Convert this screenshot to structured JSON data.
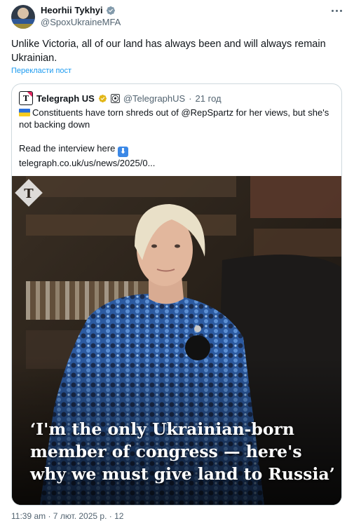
{
  "author": {
    "name": "Heorhii Tykhyi",
    "handle": "@SpoxUkraineMFA"
  },
  "tweet": {
    "text": "Unlike Victoria, all of our land has always been and will always remain Ukrainian.",
    "translate_label": "Перекласти пост"
  },
  "quote": {
    "name": "Telegraph US",
    "handle": "@TelegraphUS",
    "separator": "·",
    "time": "21 год",
    "text_line1": "Constituents have torn shreds out of @RepSpartz for her views, but she's",
    "text_line2": "not backing down",
    "read_label": "Read the interview here",
    "link": "telegraph.co.uk/us/news/2025/0..."
  },
  "image": {
    "headline_line1": "‘I'm the only Ukrainian-born",
    "headline_line2": "member of congress — here's",
    "headline_line3": "why we must give land to Russia’",
    "logo_letter": "T"
  },
  "footer": {
    "partial_text": "11:39 am · 7 лют. 2025 р. · 12"
  },
  "colors": {
    "accent": "#1d9bf0",
    "verified": "#829aab",
    "gold": "#e2b719"
  },
  "icons": [
    "verified-badge-icon",
    "more-icon",
    "gold-verified-icon",
    "soccer-ball-icon",
    "ukraine-flag-icon",
    "down-arrow-icon",
    "telegraph-logo-icon"
  ]
}
